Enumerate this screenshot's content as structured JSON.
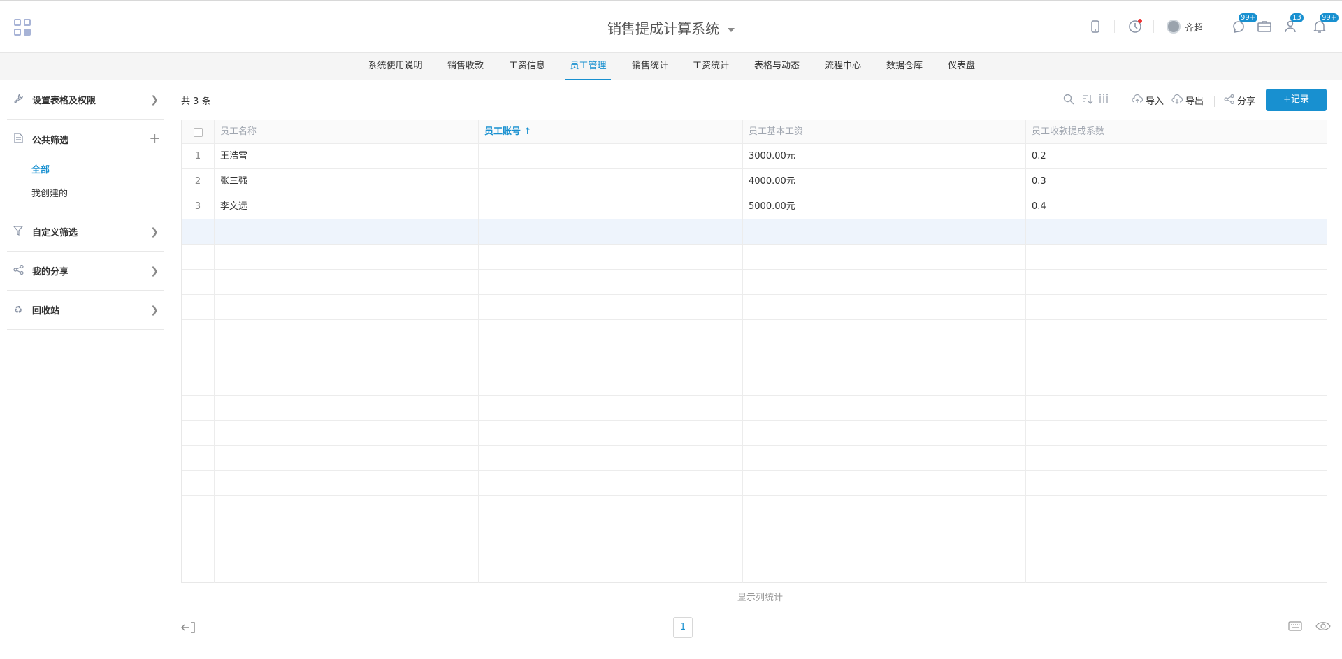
{
  "header": {
    "title": "销售提成计算系统",
    "username": "齐超",
    "badge_chat": "99+",
    "badge_tasks": "13",
    "badge_notify": "99+"
  },
  "nav": {
    "tabs": [
      "系统使用说明",
      "销售收款",
      "工资信息",
      "员工管理",
      "销售统计",
      "工资统计",
      "表格与动态",
      "流程中心",
      "数据仓库",
      "仪表盘"
    ],
    "active": "员工管理"
  },
  "sidebar": {
    "settings": "设置表格及权限",
    "public_filter": "公共筛选",
    "filter_all": "全部",
    "filter_mine": "我创建的",
    "custom_filter": "自定义筛选",
    "my_share": "我的分享",
    "recycle": "回收站"
  },
  "toolbar": {
    "count": "共 3 条",
    "import": "导入",
    "export": "导出",
    "share": "分享",
    "add": "+记录"
  },
  "table": {
    "columns": [
      "员工名称",
      "员工账号 ↑",
      "员工基本工资",
      "员工收款提成系数"
    ],
    "rows": [
      {
        "num": "1",
        "name": "王浩雷",
        "account": "",
        "salary": "3000.00元",
        "ratio": "0.2"
      },
      {
        "num": "2",
        "name": "张三强",
        "account": "",
        "salary": "4000.00元",
        "ratio": "0.3"
      },
      {
        "num": "3",
        "name": "李文远",
        "account": "",
        "salary": "5000.00元",
        "ratio": "0.4"
      }
    ]
  },
  "footer": {
    "stats": "显示列统计",
    "page": "1"
  }
}
